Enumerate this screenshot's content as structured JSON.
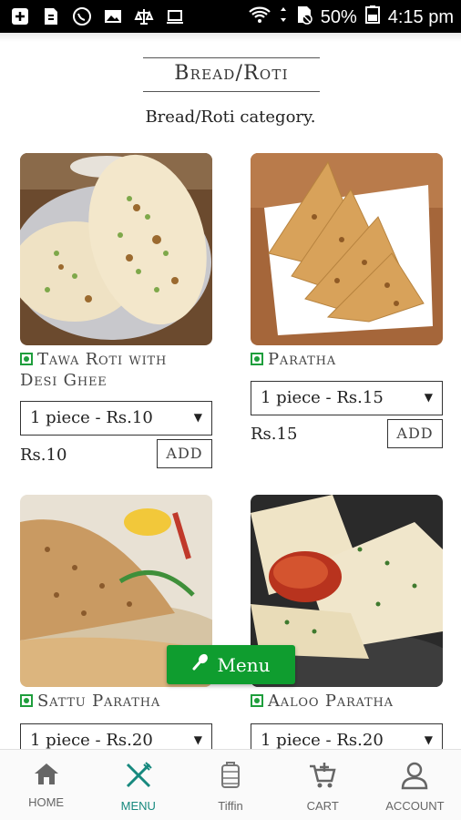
{
  "status_bar": {
    "battery": "50%",
    "time": "4:15 pm"
  },
  "category": {
    "title": "Bread/Roti",
    "description": "Bread/Roti category."
  },
  "products": [
    {
      "name_line1": "Tawa Roti with",
      "name_line2": "Desi Ghee",
      "option": "1 piece - Rs.10",
      "price": "Rs.10",
      "add_label": "ADD"
    },
    {
      "name_line1": "Paratha",
      "name_line2": "",
      "option": "1 piece - Rs.15",
      "price": "Rs.15",
      "add_label": "ADD"
    },
    {
      "name_line1": "Sattu Paratha",
      "name_line2": "",
      "option": "1 piece - Rs.20"
    },
    {
      "name_line1": "Aaloo Paratha",
      "name_line2": "",
      "option": "1 piece - Rs.20"
    }
  ],
  "fab": {
    "label": "Menu"
  },
  "nav": [
    {
      "label": "HOME"
    },
    {
      "label": "MENU"
    },
    {
      "label": "Tiffin"
    },
    {
      "label": "CART"
    },
    {
      "label": "ACCOUNT"
    }
  ],
  "colors": {
    "accent": "#17897e",
    "veg": "#1e9e3c",
    "fab": "#0f9d2f"
  }
}
